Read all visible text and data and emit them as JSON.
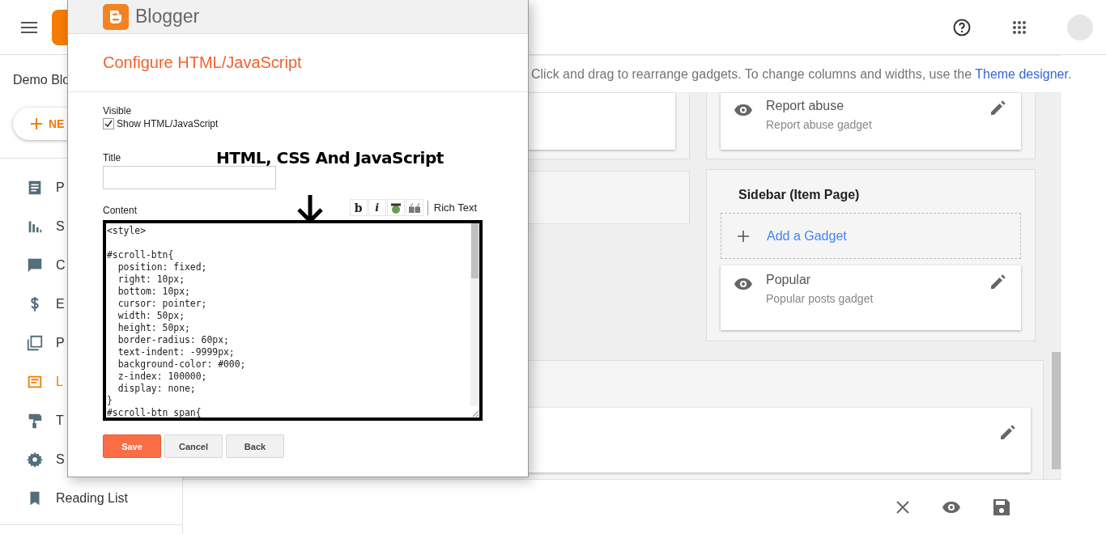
{
  "header": {
    "blog_name": "Demo Blo",
    "new_button": "NE"
  },
  "sidebar": {
    "items": [
      {
        "label": "P",
        "selected": false
      },
      {
        "label": "S",
        "selected": false
      },
      {
        "label": "C",
        "selected": false
      },
      {
        "label": "E",
        "selected": false
      },
      {
        "label": "P",
        "selected": false
      },
      {
        "label": "L",
        "selected": true
      },
      {
        "label": "T",
        "selected": false
      },
      {
        "label": "S",
        "selected": false
      },
      {
        "label": "Reading List",
        "selected": false
      }
    ]
  },
  "notice": {
    "text": "Click and drag to rearrange gadgets. To change columns and widths, use the ",
    "link": "Theme designer",
    "end": "."
  },
  "right_column": {
    "top_gadget": {
      "title": "Report abuse",
      "subtitle": "Report abuse gadget"
    },
    "section": {
      "title": "Sidebar (Item Page)",
      "add_gadget": "Add a Gadget",
      "gadgets": [
        {
          "title": "Popular",
          "subtitle": "Popular posts gadget"
        }
      ]
    }
  },
  "dialog": {
    "brand": "Blogger",
    "title": "Configure HTML/JavaScript",
    "visible_label": "Visible",
    "show_checkbox": {
      "label": "Show HTML/JavaScript",
      "checked": true
    },
    "title_label": "Title",
    "content_label": "Content",
    "toolbar": {
      "bold": "b",
      "italic": "i",
      "rich_text": "Rich Text"
    },
    "content": "<style>\n\n#scroll-btn{\n  position: fixed;\n  right: 10px;\n  bottom: 10px;\n  cursor: pointer;\n  width: 50px;\n  height: 50px;\n  border-radius: 60px;\n  text-indent: -9999px;\n  background-color: #000;\n  z-index: 100000;\n  display: none;\n}\n#scroll-btn span{",
    "buttons": {
      "save": "Save",
      "cancel": "Cancel",
      "back": "Back"
    }
  },
  "annotation": {
    "text": "HTML, CSS And JavaScript"
  }
}
